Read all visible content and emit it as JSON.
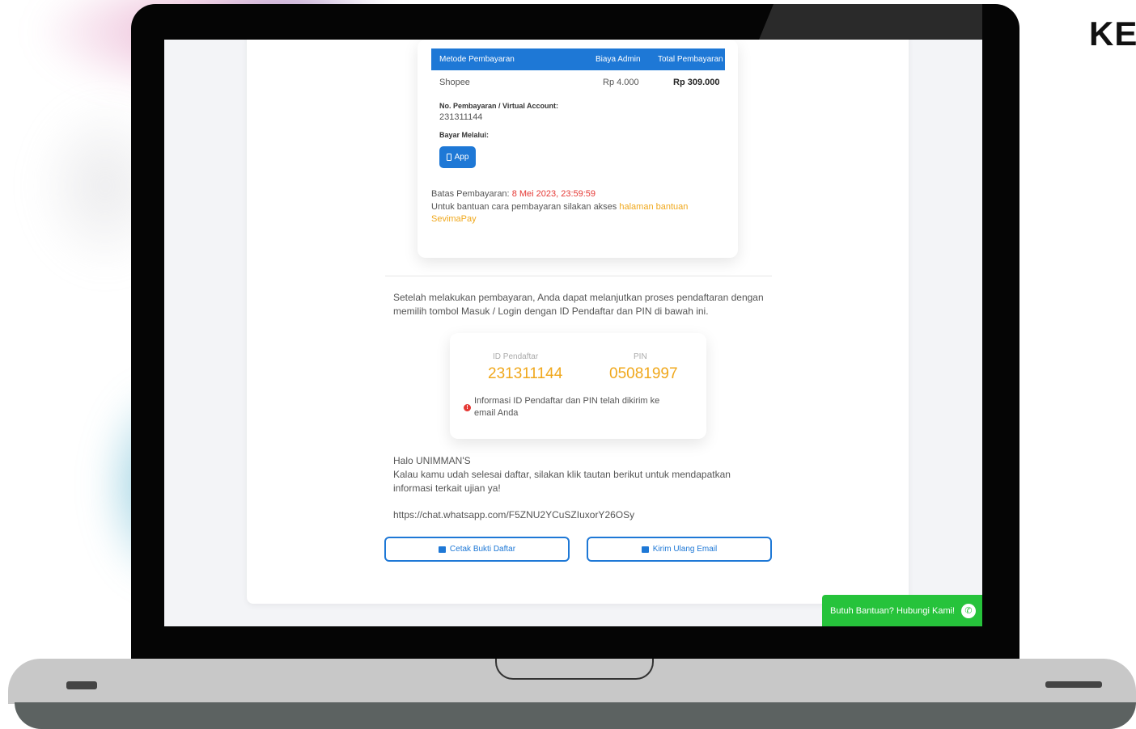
{
  "corner_title": "KE",
  "payment_table": {
    "headers": [
      "Metode Pembayaran",
      "Biaya Admin",
      "Total Pembayaran"
    ],
    "row": {
      "method": "Shopee",
      "admin_fee": "Rp 4.000",
      "total": "Rp 309.000"
    },
    "va_label": "No. Pembayaran / Virtual Account:",
    "va_number": "231311144",
    "pay_via_label": "Bayar Melalui:",
    "app_button": {
      "icon": "smartphone-icon",
      "label": "App"
    }
  },
  "deadline": {
    "label": "Batas Pembayaran:",
    "value": "8 Mei 2023, 23:59:59"
  },
  "help": {
    "text": "Untuk bantuan cara pembayaran silakan akses",
    "link": "halaman bantuan SevimaPay"
  },
  "instruction": "Setelah melakukan pembayaran, Anda dapat melanjutkan proses pendaftaran dengan memilih tombol Masuk / Login dengan ID Pendaftar dan PIN di bawah ini.",
  "credentials": {
    "id_label": "ID Pendaftar",
    "id_value": "231311144",
    "pin_label": "PIN",
    "pin_value": "05081997",
    "info": "Informasi ID Pendaftar dan PIN telah dikirim ke email Anda"
  },
  "greeting": {
    "line1": "Halo UNIMMAN'S",
    "line2": "Kalau kamu udah selesai daftar, silakan klik tautan berikut untuk mendapatkan informasi terkait ujian ya!"
  },
  "whatsapp_link": "https://chat.whatsapp.com/F5ZNU2YCuSZIuxorY26OSy",
  "buttons": {
    "print": "Cetak Bukti Daftar",
    "resend": "Kirim Ulang Email"
  },
  "help_button": {
    "label": "Butuh Bantuan? Hubungi Kami!",
    "icon": "whatsapp-icon"
  },
  "colors": {
    "primary": "#1e78d6",
    "accent": "#f0a81c",
    "danger": "#e53935",
    "whatsapp": "#26c33b"
  }
}
